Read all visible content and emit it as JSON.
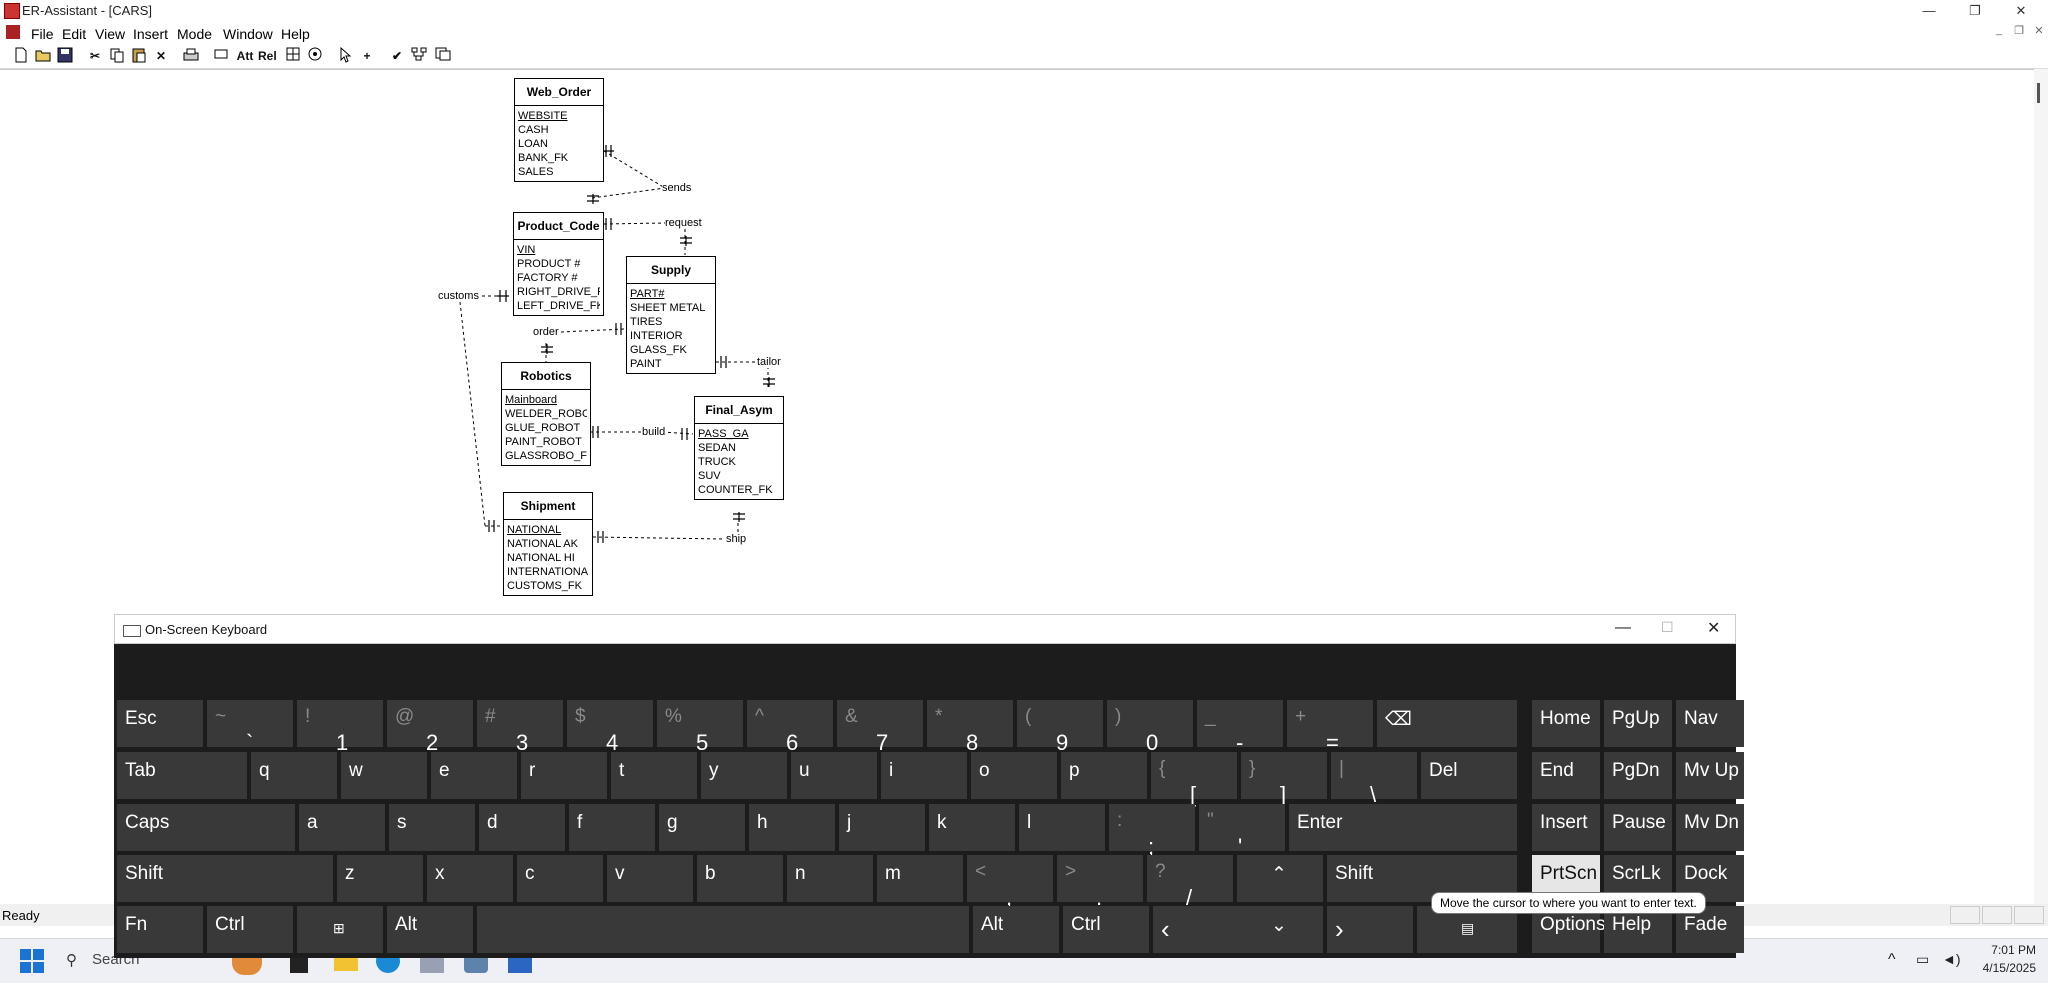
{
  "window": {
    "title": "ER-Assistant - [CARS]",
    "minimize": "—",
    "restore": "❐",
    "close": "✕"
  },
  "menu": [
    "File",
    "Edit",
    "View",
    "Insert",
    "Mode",
    "Window",
    "Help"
  ],
  "mdi": {
    "minimize": "_",
    "restore": "❐",
    "close": "✕"
  },
  "toolbar": {
    "att": "Att",
    "rel": "Rel"
  },
  "entities": [
    {
      "name": "Web_Order",
      "attrs": [
        "WEBSITE",
        "CASH",
        "LOAN",
        "BANK_FK",
        "SALES"
      ]
    },
    {
      "name": "Product_Code",
      "attrs": [
        "VIN",
        "PRODUCT #",
        "FACTORY #",
        "RIGHT_DRIVE_FK",
        "LEFT_DRIVE_FK"
      ]
    },
    {
      "name": "Supply",
      "attrs": [
        "PART#",
        "SHEET METAL",
        "TIRES",
        "INTERIOR",
        "GLASS_FK",
        "PAINT"
      ]
    },
    {
      "name": "Robotics",
      "attrs": [
        "Mainboard",
        "WELDER_ROBOT",
        "GLUE_ROBOT",
        "PAINT_ROBOT",
        "GLASSROBO_FK"
      ]
    },
    {
      "name": "Final_Asym",
      "attrs": [
        "PASS_GA",
        "SEDAN",
        "TRUCK",
        "SUV",
        "COUNTER_FK"
      ]
    },
    {
      "name": "Shipment",
      "attrs": [
        "NATIONAL",
        "NATIONAL AK",
        "NATIONAL HI",
        "INTERNATIONAL",
        "CUSTOMS_FK"
      ]
    }
  ],
  "relationships": [
    "sends",
    "request",
    "customs",
    "order",
    "tailor",
    "build",
    "ship"
  ],
  "status": {
    "text": "Ready"
  },
  "osk": {
    "title": "On-Screen Keyboard",
    "tooltip": "Move the cursor to where you want to enter text.",
    "rows": {
      "r1": [
        [
          "~",
          "`"
        ],
        [
          "!",
          "1"
        ],
        [
          "@",
          "2"
        ],
        [
          "#",
          "3"
        ],
        [
          "$",
          "4"
        ],
        [
          "%",
          "5"
        ],
        [
          "^",
          "6"
        ],
        [
          "&",
          "7"
        ],
        [
          "*",
          "8"
        ],
        [
          "(",
          "9"
        ],
        [
          ")",
          "0"
        ],
        [
          "_",
          "-"
        ],
        [
          "+",
          "="
        ]
      ],
      "r2": [
        "q",
        "w",
        "e",
        "r",
        "t",
        "y",
        "u",
        "i",
        "o",
        "p"
      ],
      "r2sym": [
        [
          "{",
          "["
        ],
        [
          "}",
          "]"
        ],
        [
          "|",
          "\\"
        ]
      ],
      "r3": [
        "a",
        "s",
        "d",
        "f",
        "g",
        "h",
        "j",
        "k",
        "l"
      ],
      "r3sym": [
        [
          ":",
          ";"
        ],
        [
          "\"",
          "'"
        ]
      ],
      "r4": [
        "z",
        "x",
        "c",
        "v",
        "b",
        "n",
        "m"
      ],
      "r4sym": [
        [
          "<",
          ","
        ],
        [
          ">",
          "."
        ],
        [
          "?",
          "/"
        ]
      ]
    },
    "keys": {
      "esc": "Esc",
      "tab": "Tab",
      "caps": "Caps",
      "shift": "Shift",
      "fn": "Fn",
      "ctrl": "Ctrl",
      "alt": "Alt",
      "del": "Del",
      "enter": "Enter",
      "home": "Home",
      "pgup": "PgUp",
      "nav": "Nav",
      "end": "End",
      "pgdn": "PgDn",
      "mvup": "Mv Up",
      "insert": "Insert",
      "pause": "Pause",
      "mvdn": "Mv Dn",
      "prtscn": "PrtScn",
      "scrlk": "ScrLk",
      "dock": "Dock",
      "options": "Options",
      "help": "Help",
      "fade": "Fade"
    }
  },
  "taskbar": {
    "search": "Search",
    "time": "7:01 PM",
    "date": "4/15/2025"
  }
}
